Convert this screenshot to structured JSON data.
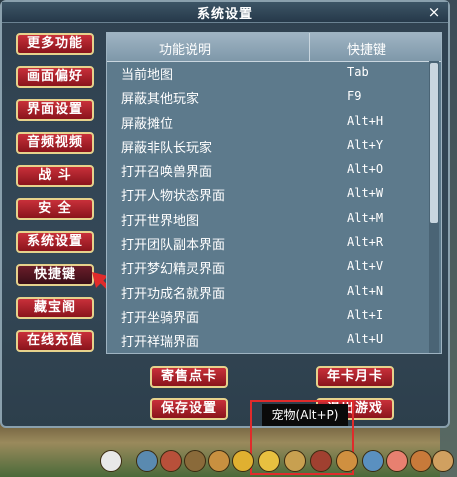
{
  "window": {
    "title": "系统设置",
    "close_label": "×"
  },
  "sidebar": {
    "items": [
      {
        "label": "更多功能"
      },
      {
        "label": "画面偏好"
      },
      {
        "label": "界面设置"
      },
      {
        "label": "音频视频"
      },
      {
        "label": "战 斗"
      },
      {
        "label": "安 全"
      },
      {
        "label": "系统设置"
      },
      {
        "label": "快捷键",
        "active": true
      },
      {
        "label": "藏宝阁"
      },
      {
        "label": "在线充值"
      }
    ]
  },
  "shortcuts": {
    "header": {
      "function": "功能说明",
      "key": "快捷键"
    },
    "rows": [
      {
        "function": "当前地图",
        "key": "Tab"
      },
      {
        "function": "屏蔽其他玩家",
        "key": "F9"
      },
      {
        "function": "屏蔽摊位",
        "key": "Alt+H"
      },
      {
        "function": "屏蔽非队长玩家",
        "key": "Alt+Y"
      },
      {
        "function": "打开召唤兽界面",
        "key": "Alt+O"
      },
      {
        "function": "打开人物状态界面",
        "key": "Alt+W"
      },
      {
        "function": "打开世界地图",
        "key": "Alt+M"
      },
      {
        "function": "打开团队副本界面",
        "key": "Alt+R"
      },
      {
        "function": "打开梦幻精灵界面",
        "key": "Alt+V"
      },
      {
        "function": "打开功成名就界面",
        "key": "Alt+N"
      },
      {
        "function": "打开坐骑界面",
        "key": "Alt+I"
      },
      {
        "function": "打开祥瑞界面",
        "key": "Alt+U"
      }
    ]
  },
  "actions": {
    "consign_card": "寄售点卡",
    "annual_card": "年卡月卡",
    "save_settings": "保存设置",
    "exit_game": "退出游戏"
  },
  "tooltip": {
    "text": "宠物(Alt+P)"
  },
  "colors": {
    "accent_red": "#c8303a",
    "button_border": "#e6d28c",
    "highlight": "#e02b2b"
  },
  "hotbar": {
    "icons": [
      "sword-icon",
      "chest-icon",
      "armor-icon",
      "fist-icon",
      "sun-icon",
      "pet-icon",
      "horse-icon",
      "bag-icon",
      "team-icon",
      "gift-icon",
      "flag-icon",
      "peach-icon",
      "bell-icon",
      "shield-icon"
    ]
  }
}
